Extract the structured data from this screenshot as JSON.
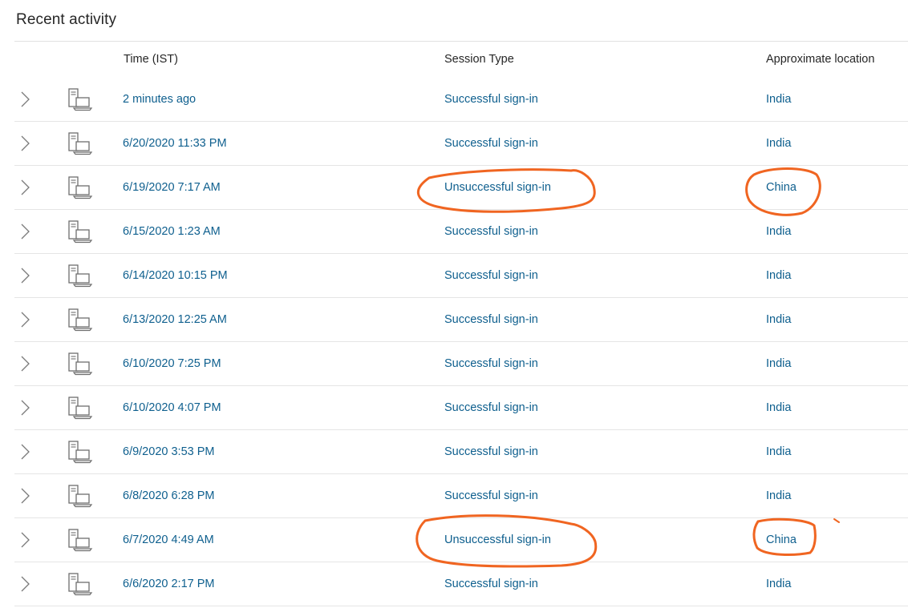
{
  "page": {
    "title": "Recent activity"
  },
  "table": {
    "columns": {
      "time": "Time (IST)",
      "session": "Session Type",
      "location": "Approximate location"
    },
    "rows": [
      {
        "time": "2 minutes ago",
        "session": "Successful sign-in",
        "location": "India"
      },
      {
        "time": "6/20/2020 11:33 PM",
        "session": "Successful sign-in",
        "location": "India"
      },
      {
        "time": "6/19/2020 7:17 AM",
        "session": "Unsuccessful sign-in",
        "location": "China"
      },
      {
        "time": "6/15/2020 1:23 AM",
        "session": "Successful sign-in",
        "location": "India"
      },
      {
        "time": "6/14/2020 10:15 PM",
        "session": "Successful sign-in",
        "location": "India"
      },
      {
        "time": "6/13/2020 12:25 AM",
        "session": "Successful sign-in",
        "location": "India"
      },
      {
        "time": "6/10/2020 7:25 PM",
        "session": "Successful sign-in",
        "location": "India"
      },
      {
        "time": "6/10/2020 4:07 PM",
        "session": "Successful sign-in",
        "location": "India"
      },
      {
        "time": "6/9/2020 3:53 PM",
        "session": "Successful sign-in",
        "location": "India"
      },
      {
        "time": "6/8/2020 6:28 PM",
        "session": "Successful sign-in",
        "location": "India"
      },
      {
        "time": "6/7/2020 4:49 AM",
        "session": "Unsuccessful sign-in",
        "location": "China"
      },
      {
        "time": "6/6/2020 2:17 PM",
        "session": "Successful sign-in",
        "location": "India"
      }
    ]
  },
  "icons": {
    "expand": "chevron-right-icon",
    "device": "computer-device-icon"
  },
  "colors": {
    "link": "#0e5f8e",
    "annotation": "#f06521",
    "divider": "#e5e5e5"
  }
}
